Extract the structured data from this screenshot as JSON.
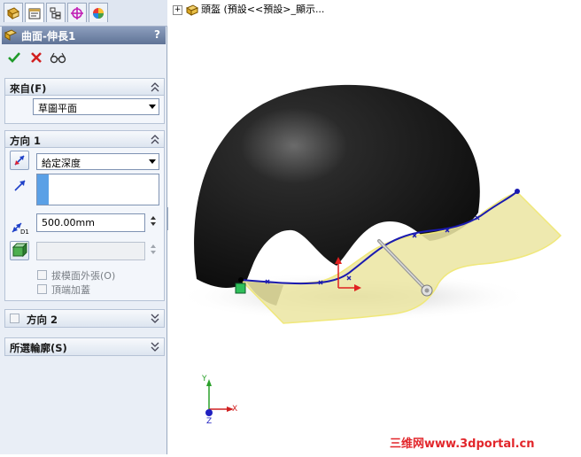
{
  "tabs": [
    {
      "icon": "feature-manager-icon"
    },
    {
      "icon": "property-manager-icon"
    },
    {
      "icon": "configuration-manager-icon"
    },
    {
      "icon": "dimxpert-icon"
    },
    {
      "icon": "display-manager-icon"
    }
  ],
  "feature": {
    "title": "曲面-伸長1",
    "help": "?"
  },
  "actions": {
    "ok_icon": "check-icon",
    "cancel_icon": "x-icon",
    "preview_icon": "glasses-icon"
  },
  "from_group": {
    "title": "來自(F)",
    "start_condition": "草圖平面"
  },
  "direction1": {
    "title": "方向 1",
    "end_condition": "給定深度",
    "depth": "500.00mm",
    "draft_label": "拔模面外張(O)",
    "cap_label": "頂端加蓋"
  },
  "direction2": {
    "title": "方向 2"
  },
  "contours": {
    "title": "所選輪廓(S)"
  },
  "tree": {
    "expand": "+",
    "text": "頭盔 (預設<<預設>_顯示..."
  },
  "triad": {
    "x": "X",
    "y": "Y",
    "z": "Z"
  },
  "watermark": "三维网www.3dportal.cn",
  "colors": {
    "helmet": "#1c1c1c",
    "surface": "#ece6a4",
    "sketch": "#1a1ab0",
    "title_bar": "#6f82a5"
  }
}
